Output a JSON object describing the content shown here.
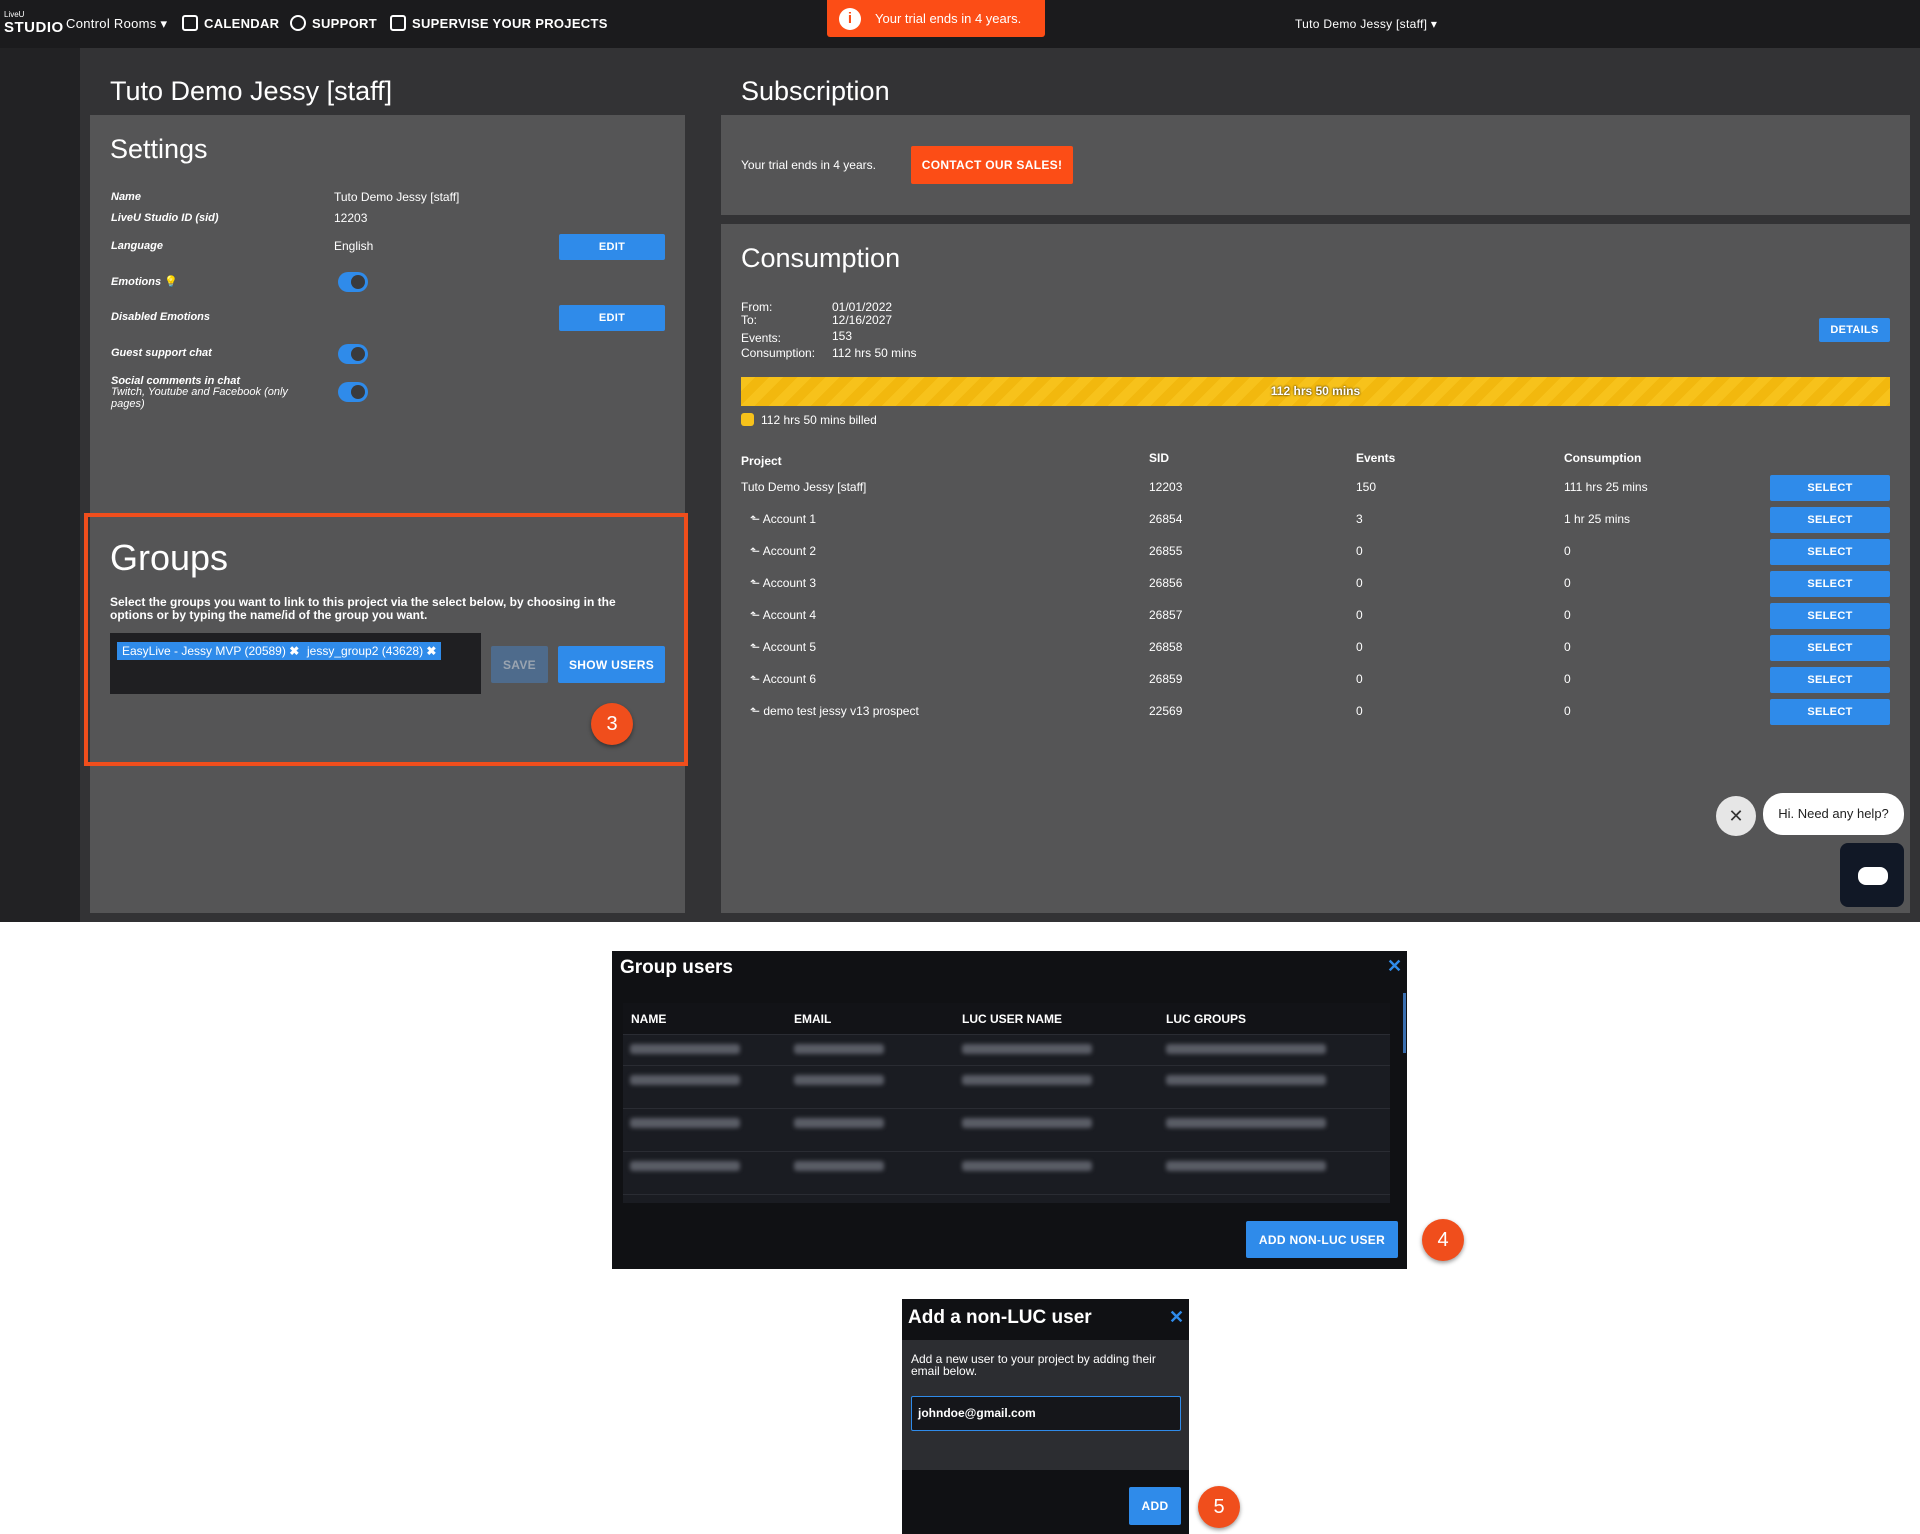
{
  "nav": {
    "logo_top": "LiveU",
    "logo": "STUDIO",
    "control_rooms": "Control Rooms",
    "calendar": "CALENDAR",
    "support": "SUPPORT",
    "supervise": "SUPERVISE YOUR PROJECTS",
    "trial_banner": "Your trial ends in 4 years.",
    "user": "Tuto Demo Jessy [staff]"
  },
  "settings": {
    "page_title": "Tuto Demo Jessy [staff]",
    "title": "Settings",
    "name_label": "Name",
    "name_value": "Tuto Demo Jessy [staff]",
    "sid_label": "LiveU Studio ID (sid)",
    "sid_value": "12203",
    "language_label": "Language",
    "language_value": "English",
    "edit_label": "EDIT",
    "emotions_label": "Emotions",
    "disabled_emotions_label": "Disabled Emotions",
    "guest_chat_label": "Guest support chat",
    "social_label": "Social comments in chat",
    "social_sub": "Twitch, Youtube and Facebook (only pages)"
  },
  "groups": {
    "title": "Groups",
    "description": "Select the groups you want to link to this project via the select below, by choosing in the options or by typing the name/id of the group you want.",
    "tags": [
      "EasyLive - Jessy MVP (20589)",
      "jessy_group2 (43628)"
    ],
    "save_label": "SAVE",
    "show_users_label": "SHOW USERS",
    "step": "3"
  },
  "subscription": {
    "title": "Subscription",
    "trial_text": "Your trial ends in 4 years.",
    "contact_label": "CONTACT OUR SALES!"
  },
  "consumption": {
    "title": "Consumption",
    "from_label": "From:",
    "from_value": "01/01/2022",
    "to_label": "To:",
    "to_value": "12/16/2027",
    "events_label": "Events:",
    "events_value": "153",
    "consumption_label": "Consumption:",
    "consumption_value": "112 hrs 50 mins",
    "details_label": "DETAILS",
    "bar_label": "112 hrs 50 mins",
    "bar_fill": 1.0,
    "billed_label": "112 hrs 50 mins billed",
    "headers": [
      "Project",
      "SID",
      "Events",
      "Consumption"
    ],
    "select_label": "SELECT",
    "rows": [
      {
        "project": "Tuto Demo Jessy [staff]",
        "sid": "12203",
        "events": "150",
        "consumption": "111 hrs 25 mins"
      },
      {
        "project": "⬑ Account 1",
        "sid": "26854",
        "events": "3",
        "consumption": "1 hr 25 mins"
      },
      {
        "project": "⬑ Account 2",
        "sid": "26855",
        "events": "0",
        "consumption": "0"
      },
      {
        "project": "⬑ Account 3",
        "sid": "26856",
        "events": "0",
        "consumption": "0"
      },
      {
        "project": "⬑ Account 4",
        "sid": "26857",
        "events": "0",
        "consumption": "0"
      },
      {
        "project": "⬑ Account 5",
        "sid": "26858",
        "events": "0",
        "consumption": "0"
      },
      {
        "project": "⬑ Account 6",
        "sid": "26859",
        "events": "0",
        "consumption": "0"
      },
      {
        "project": "⬑ demo test jessy v13 prospect",
        "sid": "22569",
        "events": "0",
        "consumption": "0"
      }
    ]
  },
  "chat": {
    "greeting": "Hi. Need any help?"
  },
  "group_users": {
    "title": "Group users",
    "headers": [
      "NAME",
      "EMAIL",
      "LUC USER NAME",
      "LUC GROUPS"
    ],
    "add_label": "ADD NON-LUC USER",
    "step": "4"
  },
  "add_user": {
    "title": "Add a non-LUC user",
    "description": "Add a new user to your project by adding their email below.",
    "email_value": "johndoe@gmail.com",
    "add_label": "ADD",
    "step": "5"
  }
}
